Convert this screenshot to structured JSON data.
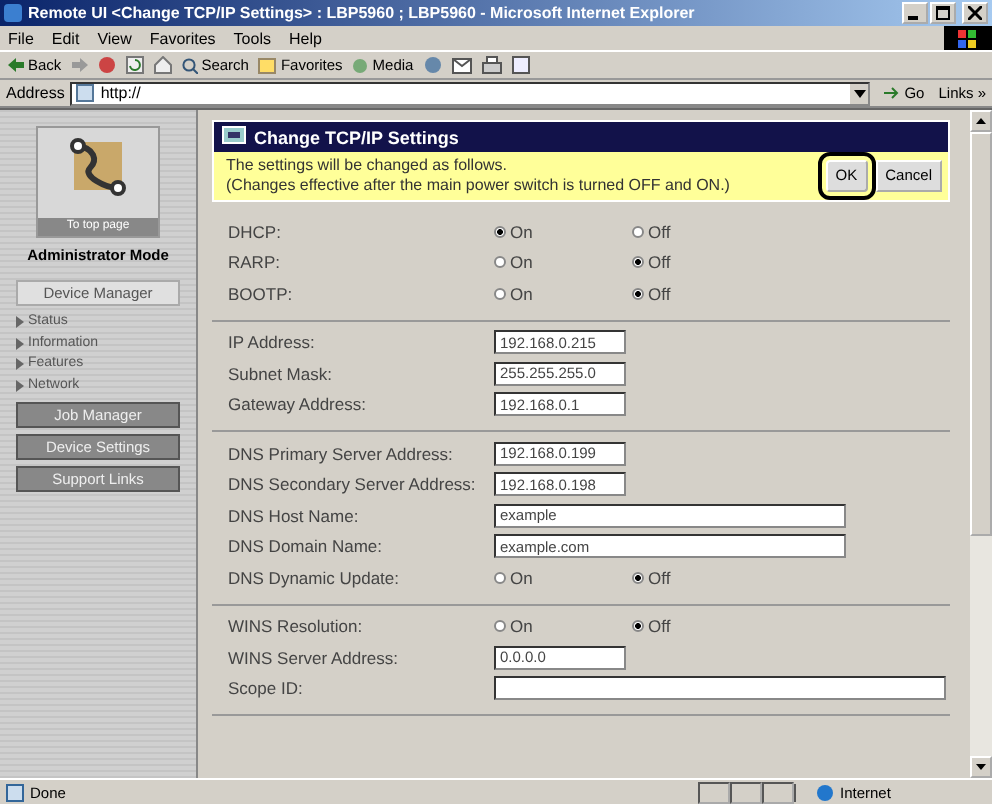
{
  "window": {
    "title": "Remote UI <Change TCP/IP Settings> : LBP5960 ; LBP5960 - Microsoft Internet Explorer"
  },
  "menu": [
    "File",
    "Edit",
    "View",
    "Favorites",
    "Tools",
    "Help"
  ],
  "toolbar": [
    "Back",
    "Search",
    "Favorites",
    "Media"
  ],
  "address": {
    "label": "Address",
    "value": "http://",
    "go": "Go",
    "links": "Links »"
  },
  "sidebar": {
    "top_link": "To top page",
    "mode": "Administrator Mode",
    "device_manager": "Device Manager",
    "items": [
      "Status",
      "Information",
      "Features",
      "Network"
    ],
    "buttons": [
      "Job Manager",
      "Device Settings",
      "Support Links"
    ]
  },
  "dialog": {
    "title": "Change TCP/IP Settings",
    "message": "The settings will be changed as follows.",
    "note": "(Changes effective after the main power switch is turned OFF and ON.)",
    "buttons": [
      {
        "label": "OK",
        "highlighted": true
      },
      {
        "label": "Cancel",
        "highlighted": false
      }
    ]
  },
  "sections": [
    {
      "rows": [
        {
          "label": "DHCP:",
          "kind": "radio",
          "options": [
            {
              "label": "On",
              "selected": true
            },
            {
              "label": "Off",
              "selected": false
            }
          ]
        },
        {
          "label": "RARP:",
          "kind": "radio",
          "options": [
            {
              "label": "On",
              "selected": false
            },
            {
              "label": "Off",
              "selected": true
            }
          ]
        },
        {
          "label": "BOOTP:",
          "kind": "radio",
          "options": [
            {
              "label": "On",
              "selected": false
            },
            {
              "label": "Off",
              "selected": true
            }
          ]
        }
      ]
    },
    {
      "rows": [
        {
          "label": "IP Address:",
          "kind": "field",
          "value": "192.168.0.215"
        },
        {
          "label": "Subnet Mask:",
          "kind": "field",
          "value": "255.255.255.0"
        },
        {
          "label": "Gateway Address:",
          "kind": "field",
          "value": "192.168.0.1"
        }
      ]
    },
    {
      "rows": [
        {
          "label": "DNS Primary Server Address:",
          "kind": "field",
          "value": "192.168.0.199"
        },
        {
          "label": "DNS Secondary Server Address:",
          "kind": "field",
          "value": "192.168.0.198"
        },
        {
          "label": "DNS Host Name:",
          "kind": "wide_field",
          "value": "example"
        },
        {
          "label": "DNS Domain Name:",
          "kind": "wide_field",
          "value": "example.com"
        },
        {
          "label": "DNS Dynamic Update:",
          "kind": "radio",
          "options": [
            {
              "label": "On",
              "selected": false
            },
            {
              "label": "Off",
              "selected": true
            }
          ]
        }
      ]
    },
    {
      "rows": [
        {
          "label": "WINS Resolution:",
          "kind": "radio",
          "options": [
            {
              "label": "On",
              "selected": false
            },
            {
              "label": "Off",
              "selected": true
            }
          ]
        },
        {
          "label": "WINS Server Address:",
          "kind": "field",
          "value": "0.0.0.0"
        },
        {
          "label": "Scope ID:",
          "kind": "full_field",
          "value": ""
        }
      ]
    }
  ],
  "status_bar": {
    "text": "Done",
    "zone": "Internet"
  }
}
